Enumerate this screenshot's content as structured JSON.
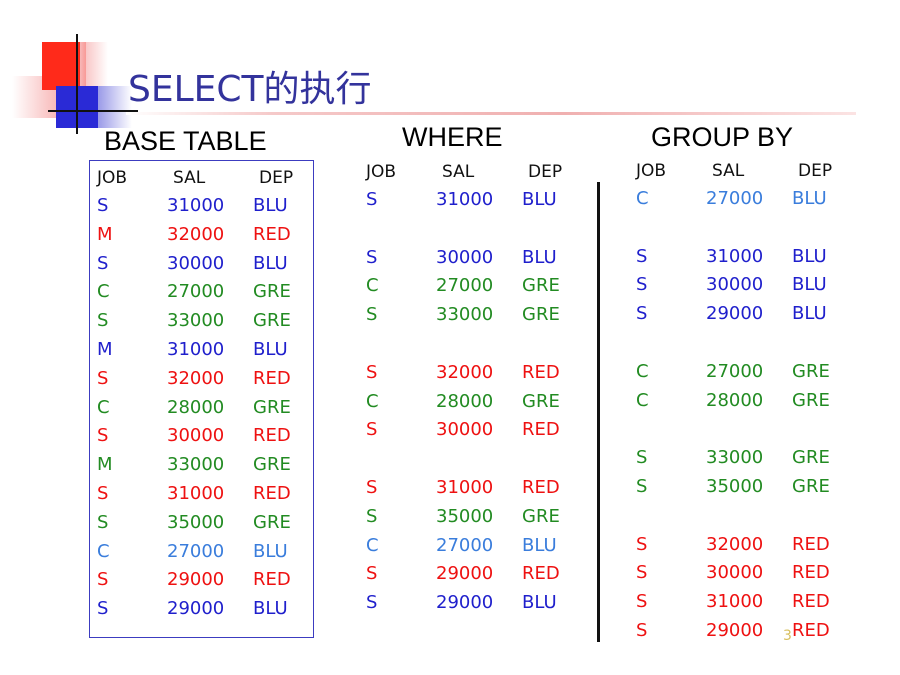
{
  "slide": {
    "title": "SELECT的执行",
    "page_number": "3"
  },
  "colors": {
    "title": "#33339c",
    "blu": "#1f1fcc",
    "red": "#ee1111",
    "gre": "#228b22",
    "light_blue": "#3a7ddc"
  },
  "sections": {
    "base": {
      "heading": "BASE TABLE",
      "columns": [
        "JOB",
        "SAL",
        "DEP"
      ],
      "rows": [
        {
          "job": "S",
          "sal": "31000",
          "dep": "BLU",
          "color": "blu"
        },
        {
          "job": "M",
          "sal": "32000",
          "dep": "RED",
          "color": "red"
        },
        {
          "job": "S",
          "sal": "30000",
          "dep": "BLU",
          "color": "blu"
        },
        {
          "job": "C",
          "sal": "27000",
          "dep": "GRE",
          "color": "gre"
        },
        {
          "job": "S",
          "sal": "33000",
          "dep": "GRE",
          "color": "gre"
        },
        {
          "job": "M",
          "sal": "31000",
          "dep": "BLU",
          "color": "blu"
        },
        {
          "job": "S",
          "sal": "32000",
          "dep": "RED",
          "color": "red"
        },
        {
          "job": "C",
          "sal": "28000",
          "dep": "GRE",
          "color": "gre"
        },
        {
          "job": "S",
          "sal": "30000",
          "dep": "RED",
          "color": "red"
        },
        {
          "job": "M",
          "sal": "33000",
          "dep": "GRE",
          "color": "gre"
        },
        {
          "job": "S",
          "sal": "31000",
          "dep": "RED",
          "color": "red"
        },
        {
          "job": "S",
          "sal": "35000",
          "dep": "GRE",
          "color": "gre"
        },
        {
          "job": "C",
          "sal": "27000",
          "dep": "BLU",
          "color": "lblu"
        },
        {
          "job": "S",
          "sal": "29000",
          "dep": "RED",
          "color": "red"
        },
        {
          "job": "S",
          "sal": "29000",
          "dep": "BLU",
          "color": "blu"
        }
      ]
    },
    "where": {
      "heading": "WHERE",
      "columns": [
        "JOB",
        "SAL",
        "DEP"
      ],
      "rows": [
        {
          "job": "S",
          "sal": "31000",
          "dep": "BLU",
          "color": "blu",
          "slot": 0
        },
        {
          "job": "S",
          "sal": "30000",
          "dep": "BLU",
          "color": "blu",
          "slot": 2
        },
        {
          "job": "C",
          "sal": "27000",
          "dep": "GRE",
          "color": "gre",
          "slot": 3
        },
        {
          "job": "S",
          "sal": "33000",
          "dep": "GRE",
          "color": "gre",
          "slot": 4
        },
        {
          "job": "S",
          "sal": "32000",
          "dep": "RED",
          "color": "red",
          "slot": 6
        },
        {
          "job": "C",
          "sal": "28000",
          "dep": "GRE",
          "color": "gre",
          "slot": 7
        },
        {
          "job": "S",
          "sal": "30000",
          "dep": "RED",
          "color": "red",
          "slot": 8
        },
        {
          "job": "S",
          "sal": "31000",
          "dep": "RED",
          "color": "red",
          "slot": 10
        },
        {
          "job": "S",
          "sal": "35000",
          "dep": "GRE",
          "color": "gre",
          "slot": 11
        },
        {
          "job": "C",
          "sal": "27000",
          "dep": "BLU",
          "color": "lblu",
          "slot": 12
        },
        {
          "job": "S",
          "sal": "29000",
          "dep": "RED",
          "color": "red",
          "slot": 13
        },
        {
          "job": "S",
          "sal": "29000",
          "dep": "BLU",
          "color": "blu",
          "slot": 14
        }
      ]
    },
    "group_by": {
      "heading": "GROUP BY",
      "columns": [
        "JOB",
        "SAL",
        "DEP"
      ],
      "rows": [
        {
          "job": "C",
          "sal": "27000",
          "dep": "BLU",
          "color": "lblu",
          "slot": 0
        },
        {
          "job": "S",
          "sal": "31000",
          "dep": "BLU",
          "color": "blu",
          "slot": 2
        },
        {
          "job": "S",
          "sal": "30000",
          "dep": "BLU",
          "color": "blu",
          "slot": 3
        },
        {
          "job": "S",
          "sal": "29000",
          "dep": "BLU",
          "color": "blu",
          "slot": 4
        },
        {
          "job": "C",
          "sal": "27000",
          "dep": "GRE",
          "color": "gre",
          "slot": 6
        },
        {
          "job": "C",
          "sal": "28000",
          "dep": "GRE",
          "color": "gre",
          "slot": 7
        },
        {
          "job": "S",
          "sal": "33000",
          "dep": "GRE",
          "color": "gre",
          "slot": 9
        },
        {
          "job": "S",
          "sal": "35000",
          "dep": "GRE",
          "color": "gre",
          "slot": 10
        },
        {
          "job": "S",
          "sal": "32000",
          "dep": "RED",
          "color": "red",
          "slot": 12
        },
        {
          "job": "S",
          "sal": "30000",
          "dep": "RED",
          "color": "red",
          "slot": 13
        },
        {
          "job": "S",
          "sal": "31000",
          "dep": "RED",
          "color": "red",
          "slot": 14
        },
        {
          "job": "S",
          "sal": "29000",
          "dep": "RED",
          "color": "red",
          "slot": 15
        }
      ]
    }
  }
}
